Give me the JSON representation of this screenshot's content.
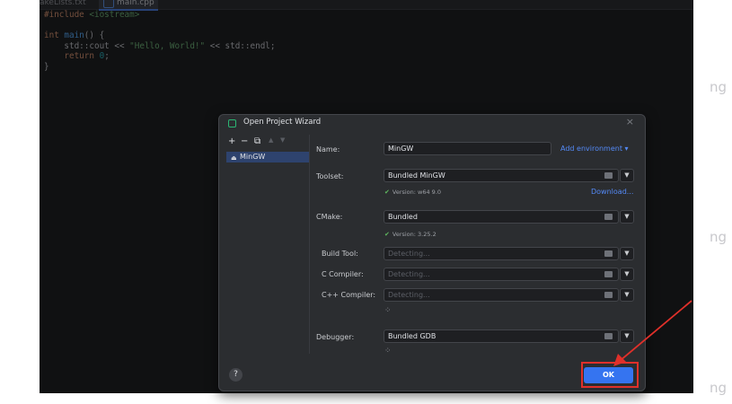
{
  "editor": {
    "tabs": [
      "akeLists.txt",
      "main.cpp"
    ],
    "code_lines": [
      {
        "parts": [
          {
            "t": "#include ",
            "c": "kw"
          },
          {
            "t": "<iostream>",
            "c": "inc"
          }
        ]
      },
      {
        "parts": [
          {
            "t": "",
            "c": ""
          }
        ]
      },
      {
        "parts": [
          {
            "t": "int ",
            "c": "kw"
          },
          {
            "t": "main",
            "c": "fn"
          },
          {
            "t": "() {",
            "c": ""
          }
        ]
      },
      {
        "parts": [
          {
            "t": "    std::cout << ",
            "c": ""
          },
          {
            "t": "\"Hello, World!\"",
            "c": "str"
          },
          {
            "t": " << std::endl;",
            "c": ""
          }
        ]
      },
      {
        "parts": [
          {
            "t": "    ",
            "c": ""
          },
          {
            "t": "return ",
            "c": "kw"
          },
          {
            "t": "0",
            "c": "num"
          },
          {
            "t": ";",
            "c": ""
          }
        ]
      },
      {
        "parts": [
          {
            "t": "}",
            "c": ""
          }
        ]
      }
    ]
  },
  "dialog": {
    "title": "Open Project Wizard",
    "close_icon": "×",
    "toolbar": {
      "add": "+",
      "remove": "−",
      "copy": "⧉",
      "up": "▲",
      "down": "▼"
    },
    "environments": [
      "MinGW"
    ],
    "name_label": "Name:",
    "name_value": "MinGW",
    "add_environment": "Add environment ▾",
    "toolset_label": "Toolset:",
    "toolset_value": "Bundled MinGW",
    "toolset_version": "Version: w64 9.0",
    "download_link": "Download...",
    "cmake_label": "CMake:",
    "cmake_value": "Bundled",
    "cmake_version": "Version: 3.25.2",
    "build_tool_label": "Build Tool:",
    "build_tool_value": "Detecting...",
    "c_compiler_label": "C Compiler:",
    "c_compiler_value": "Detecting...",
    "cpp_compiler_label": "C++ Compiler:",
    "cpp_compiler_value": "Detecting...",
    "debugger_label": "Debugger:",
    "debugger_value": "Bundled GDB",
    "help": "?",
    "ok": "OK"
  },
  "watermark": "ng",
  "colors": {
    "accent": "#3574f0",
    "highlight": "#e0302a",
    "success": "#5fb85f"
  }
}
